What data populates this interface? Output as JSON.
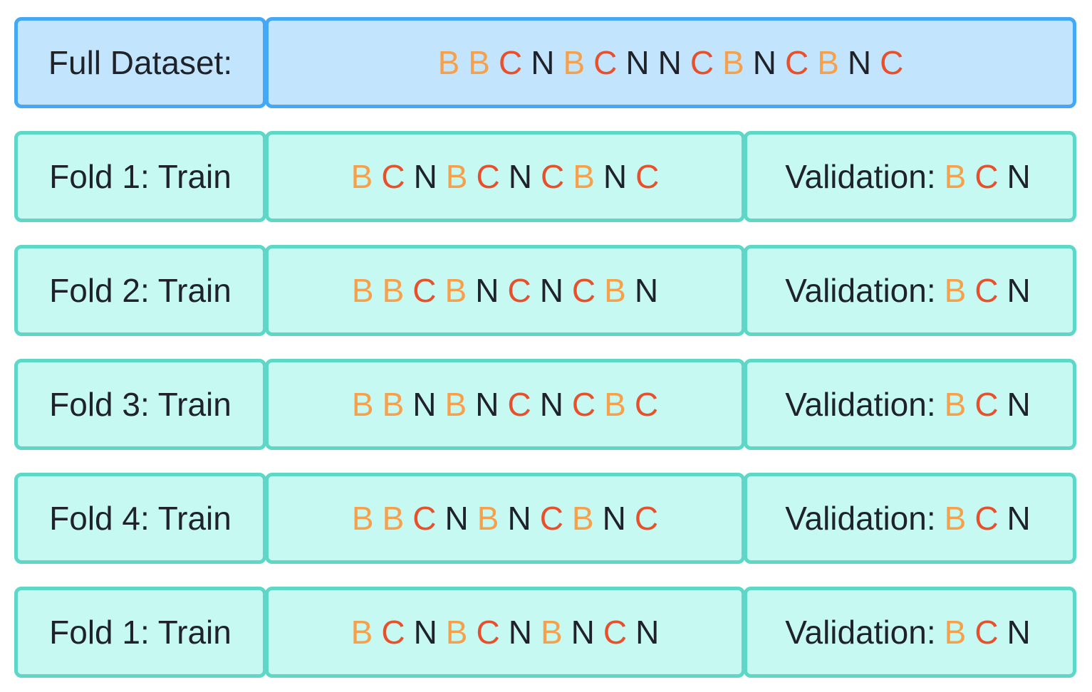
{
  "colors": {
    "B": "#f6a04c",
    "C": "#e8502b",
    "N": "#1f2329",
    "full_fill": "#c2e5fd",
    "full_border": "#44a8f5",
    "fold_fill": "#c7f9f3",
    "fold_border": "#5ed7c9"
  },
  "full": {
    "label": "Full Dataset:",
    "sequence": [
      "B",
      "B",
      "C",
      "N",
      "B",
      "C",
      "N",
      "N",
      "C",
      "B",
      "N",
      "C",
      "B",
      "N",
      "C"
    ]
  },
  "folds": [
    {
      "label": "Fold 1: Train",
      "train": [
        "B",
        "C",
        "N",
        "B",
        "C",
        "N",
        "C",
        "B",
        "N",
        "C"
      ],
      "validation_label": "Validation:",
      "validation": [
        "B",
        "C",
        "N"
      ]
    },
    {
      "label": "Fold 2: Train",
      "train": [
        "B",
        "B",
        "C",
        "B",
        "N",
        "C",
        "N",
        "C",
        "B",
        "N"
      ],
      "validation_label": "Validation:",
      "validation": [
        "B",
        "C",
        "N"
      ]
    },
    {
      "label": "Fold 3: Train",
      "train": [
        "B",
        "B",
        "N",
        "B",
        "N",
        "C",
        "N",
        "C",
        "B",
        "C"
      ],
      "validation_label": "Validation:",
      "validation": [
        "B",
        "C",
        "N"
      ]
    },
    {
      "label": "Fold 4: Train",
      "train": [
        "B",
        "B",
        "C",
        "N",
        "B",
        "N",
        "C",
        "B",
        "N",
        "C"
      ],
      "validation_label": "Validation:",
      "validation": [
        "B",
        "C",
        "N"
      ]
    },
    {
      "label": "Fold 1: Train",
      "train": [
        "B",
        "C",
        "N",
        "B",
        "C",
        "N",
        "B",
        "N",
        "C",
        "N"
      ],
      "validation_label": "Validation:",
      "validation": [
        "B",
        "C",
        "N"
      ]
    }
  ]
}
